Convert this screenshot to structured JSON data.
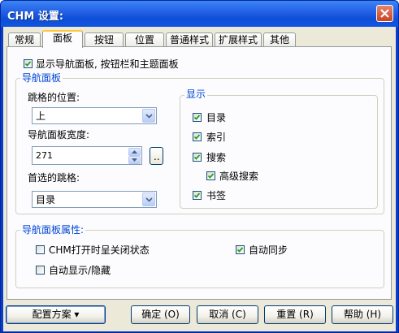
{
  "window": {
    "title": "CHM 设置:"
  },
  "tabs": [
    {
      "label": "常规"
    },
    {
      "label": "面板"
    },
    {
      "label": "按钮"
    },
    {
      "label": "位置"
    },
    {
      "label": "普通样式"
    },
    {
      "label": "扩展样式"
    },
    {
      "label": "其他"
    }
  ],
  "active_tab": "面板",
  "panel": {
    "show_panes": {
      "label": "显示导航面板, 按钮栏和主题面板",
      "checked": true
    },
    "nav_group": {
      "title": "导航面板",
      "tab_position_label": "跳格的位置:",
      "tab_position_value": "上",
      "width_label": "导航面板宽度:",
      "width_value": "271",
      "browse_label": "..",
      "preferred_tab_label": "首选的跳格:",
      "preferred_tab_value": "目录"
    },
    "display_group": {
      "title": "显示",
      "items": [
        {
          "label": "目录",
          "checked": true
        },
        {
          "label": "索引",
          "checked": true
        },
        {
          "label": "搜索",
          "checked": true
        },
        {
          "label": "高级搜索",
          "checked": true
        },
        {
          "label": "书签",
          "checked": true
        }
      ]
    },
    "props_group": {
      "title": "导航面板属性:",
      "closed_on_open": {
        "label": "CHM打开时呈关闭状态",
        "checked": false
      },
      "auto_sync": {
        "label": "自动同步",
        "checked": true
      },
      "auto_show_hide": {
        "label": "自动显示/隐藏",
        "checked": false
      }
    }
  },
  "buttons": {
    "config": "配置方案 ▾",
    "ok": "确定 (O)",
    "cancel": "取消 (C)",
    "reset": "重置 (R)",
    "help": "帮助 (H)"
  },
  "colors": {
    "titlebar": "#0a3ec8",
    "client": "#ece9d8",
    "group_legend": "#0046d5",
    "close_button": "#c8441f",
    "checkmark": "#21a121",
    "active_tab_highlight": "#ffc83c"
  }
}
